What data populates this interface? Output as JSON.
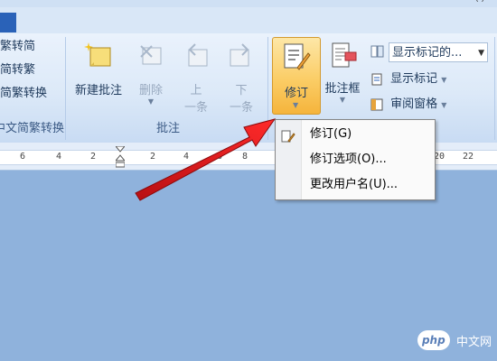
{
  "window": {
    "controls_fragment": "(  )"
  },
  "chinese_group": {
    "items": [
      {
        "label": "繁转简"
      },
      {
        "label": "简转繁"
      },
      {
        "label": "简繁转换"
      }
    ],
    "group_label": "中文简繁转换"
  },
  "comments_group": {
    "new_comment": "新建批注",
    "delete": "删除",
    "prev_line1": "上",
    "prev_line2": "一条",
    "next_line1": "下",
    "next_line2": "一条",
    "group_label": "批注"
  },
  "tracking_group": {
    "track_changes": "修订",
    "balloons": "批注框",
    "display_combo_value": "显示标记的...",
    "show_markup": "显示标记",
    "reviewing_pane": "审阅窗格"
  },
  "ruler": {
    "left_numbers": [
      "6",
      "4",
      "2"
    ],
    "right_numbers": [
      "2",
      "4",
      "6",
      "8",
      "20",
      "22"
    ]
  },
  "context_menu": {
    "items": [
      {
        "label": "修订(G)"
      },
      {
        "label": "修订选项(O)..."
      },
      {
        "label": "更改用户名(U)..."
      }
    ]
  },
  "watermark": {
    "logo": "php",
    "text": "中文网"
  },
  "colors": {
    "accent_arrow": "#e0191c",
    "selected_button": "#fbcd66",
    "doc_background": "#8fb2dc"
  }
}
